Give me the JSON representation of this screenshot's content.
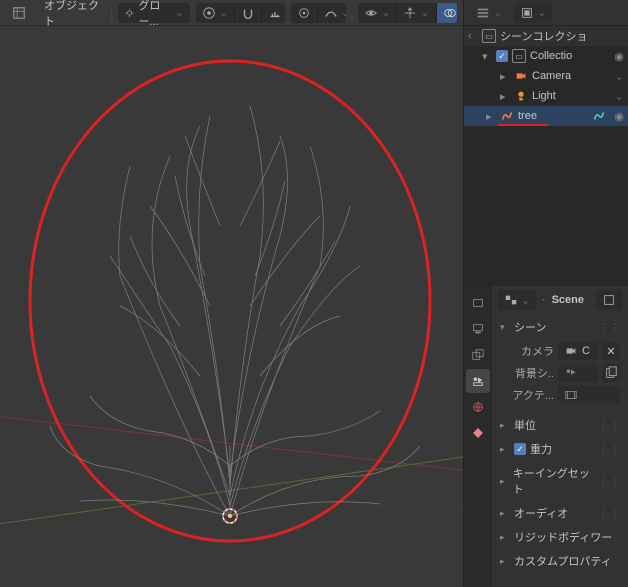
{
  "header": {
    "mode": "オブジェクト",
    "orientation": "グロー..."
  },
  "outliner": {
    "root": "シーンコレクショ",
    "collection": "Collectio",
    "items": [
      {
        "name": "Camera",
        "type": "camera"
      },
      {
        "name": "Light",
        "type": "light"
      },
      {
        "name": "tree",
        "type": "curve"
      }
    ]
  },
  "properties": {
    "scene_name": "Scene",
    "panels": {
      "scene": "シーン",
      "camera_lbl": "カメラ",
      "camera_val": "C",
      "bgscene_lbl": "背景シ..",
      "active_lbl": "アクテ...",
      "units": "単位",
      "gravity": "重力",
      "keying": "キーイングセット",
      "audio": "オーディオ",
      "rigid": "リジッドボディワー",
      "custom": "カスタムプロパティ"
    }
  }
}
